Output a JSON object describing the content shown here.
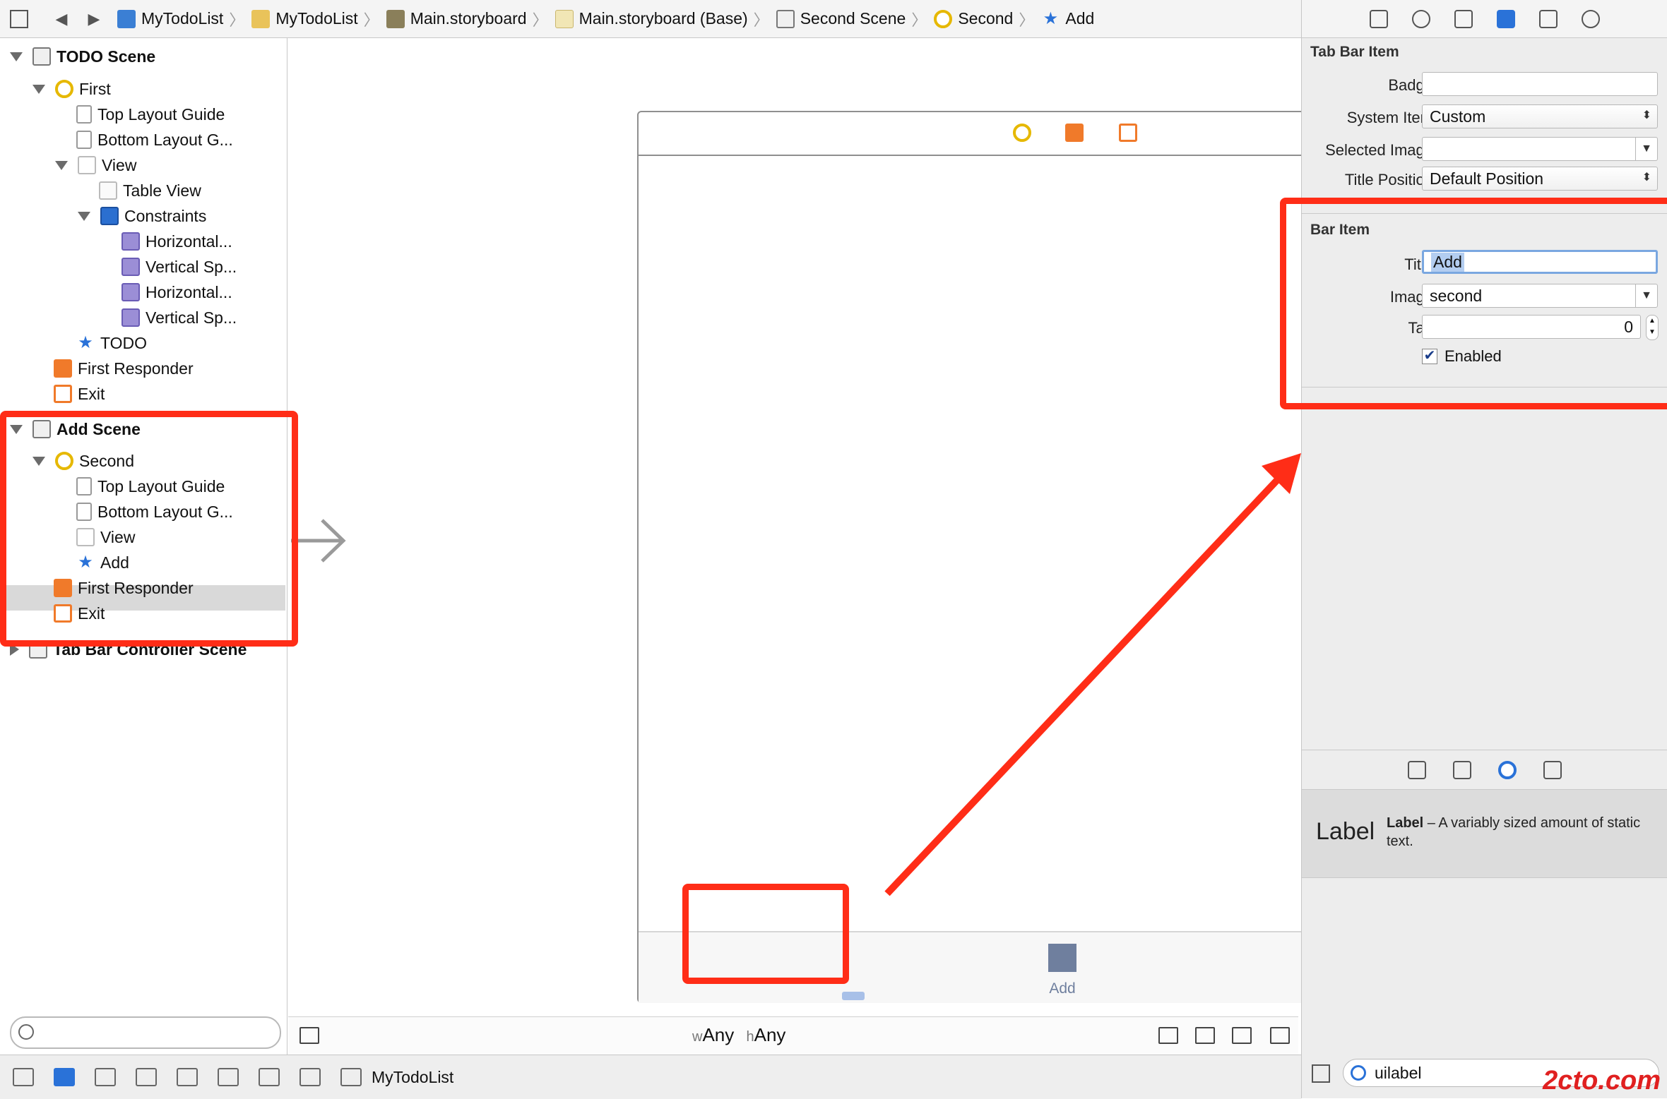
{
  "jumpbar": {
    "crumbs": [
      "MyTodoList",
      "MyTodoList",
      "Main.storyboard",
      "Main.storyboard (Base)",
      "Second Scene",
      "Second",
      "Add"
    ]
  },
  "navigator": {
    "todo_scene": "TODO Scene",
    "first": "First",
    "top_layout_guide": "Top Layout Guide",
    "bottom_layout_guide": "Bottom Layout G...",
    "view": "View",
    "table_view": "Table View",
    "constraints": "Constraints",
    "c_h1": "Horizontal...",
    "c_v1": "Vertical Sp...",
    "c_h2": "Horizontal...",
    "c_v2": "Vertical Sp...",
    "todo": "TODO",
    "first_responder": "First Responder",
    "exit": "Exit",
    "add_scene": "Add Scene",
    "second": "Second",
    "add": "Add",
    "tabbar_scene": "Tab Bar Controller Scene"
  },
  "canvas": {
    "tab_label": "Add",
    "size_w_prefix": "w",
    "size_w": "Any",
    "size_h_prefix": "h",
    "size_h": "Any"
  },
  "debugbar": {
    "target": "MyTodoList"
  },
  "inspector": {
    "tab_bar_item_title": "Tab Bar Item",
    "badge_label": "Badge",
    "badge_value": "",
    "system_item_label": "System Item",
    "system_item_value": "Custom",
    "selected_image_label": "Selected Image",
    "selected_image_value": "",
    "title_position_label": "Title Position",
    "title_position_value": "Default Position",
    "bar_item_title": "Bar Item",
    "title_label": "Title",
    "title_value": "Add",
    "image_label": "Image",
    "image_value": "second",
    "tag_label": "Tag",
    "tag_value": "0",
    "enabled_label": "Enabled"
  },
  "library": {
    "item_preview": "Label",
    "item_name": "Label",
    "item_desc": " – A variably sized amount of static text.",
    "search_value": "uilabel"
  },
  "watermark": "2cto.com",
  "colors": {
    "annotation_red": "#ff2d17",
    "accent_blue": "#2a72d8"
  }
}
